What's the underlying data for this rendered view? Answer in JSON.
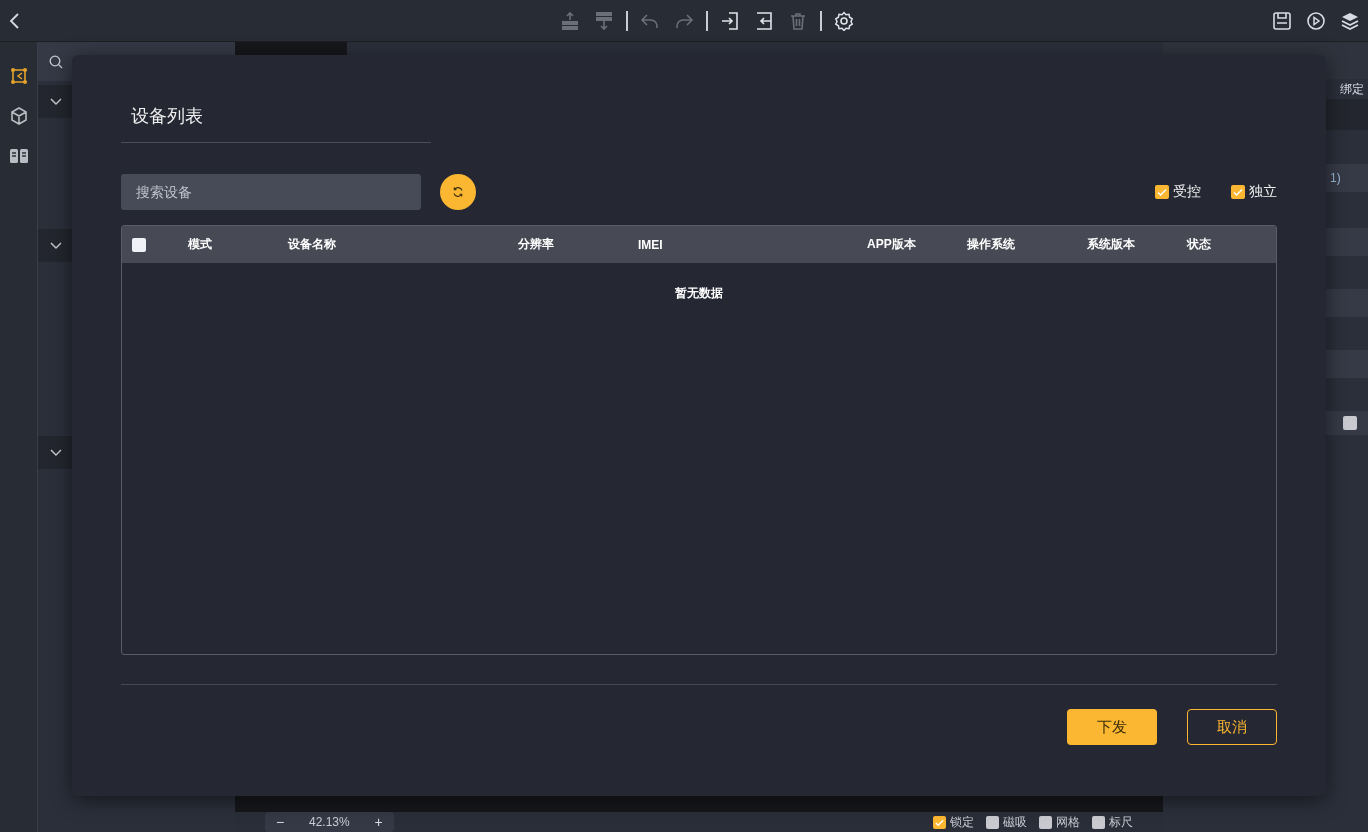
{
  "toolbar_groups": [
    [
      {
        "kind": "insert-above",
        "disabled": true
      },
      {
        "kind": "insert-below",
        "disabled": true
      }
    ],
    [
      {
        "kind": "undo",
        "disabled": true
      },
      {
        "kind": "redo",
        "disabled": true
      }
    ],
    [
      {
        "kind": "import",
        "disabled": false
      },
      {
        "kind": "export",
        "disabled": false
      },
      {
        "kind": "delete",
        "disabled": true
      }
    ],
    [
      {
        "kind": "settings",
        "disabled": false
      }
    ]
  ],
  "right_actions": [
    {
      "kind": "save"
    },
    {
      "kind": "play"
    },
    {
      "kind": "layers"
    }
  ],
  "rail": [
    {
      "kind": "canvas",
      "selected": true
    },
    {
      "kind": "cube",
      "selected": false
    },
    {
      "kind": "library",
      "selected": false
    }
  ],
  "right_panel": {
    "label": "绑定",
    "value": "1)",
    "checkbox": {
      "checked": false
    }
  },
  "bottom_bar": {
    "zoom_out": "−",
    "zoom": "42.13%",
    "zoom_in": "+",
    "options": [
      {
        "label": "锁定",
        "checked": true
      },
      {
        "label": "磁吸",
        "checked": false
      },
      {
        "label": "网格",
        "checked": false
      },
      {
        "label": "标尺",
        "checked": false
      }
    ]
  },
  "dialog": {
    "title": "设备列表",
    "search": {
      "placeholder": "搜索设备"
    },
    "filters": [
      {
        "label": "受控",
        "checked": true
      },
      {
        "label": "独立",
        "checked": true
      }
    ],
    "table": {
      "select_all": {
        "checked": false
      },
      "columns": [
        "模式",
        "设备名称",
        "分辨率",
        "IMEI",
        "APP版本",
        "操作系统",
        "系统版本",
        "状态"
      ],
      "empty_text": "暂无数据"
    },
    "buttons": [
      {
        "label": "下发",
        "kind": "primary"
      },
      {
        "label": "取消",
        "kind": "secondary"
      }
    ]
  }
}
